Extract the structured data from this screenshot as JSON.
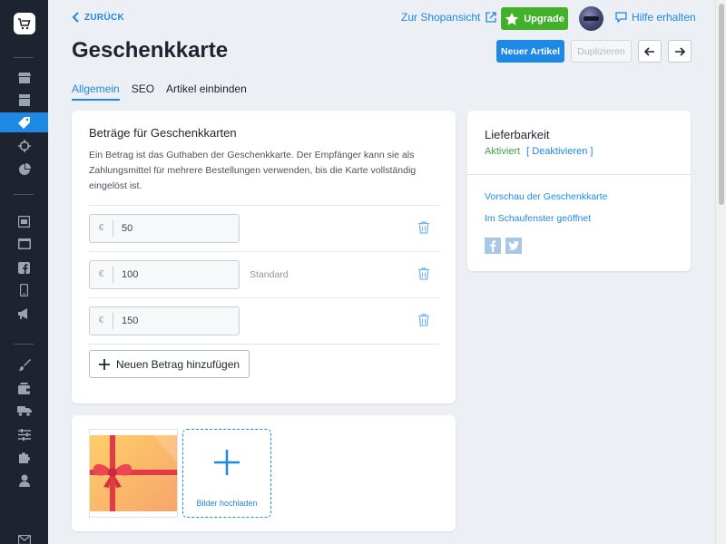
{
  "header": {
    "back_label": "ZURÜCK",
    "shop_link": "Zur Shopansicht",
    "upgrade_label": "Upgrade",
    "help_label": "Hilfe erhalten"
  },
  "page": {
    "title": "Geschenkkarte",
    "new_item_label": "Neuer Artikel",
    "duplicate_label": "Duplizieren"
  },
  "tabs": [
    {
      "label": "Allgemein",
      "active": true
    },
    {
      "label": "SEO",
      "active": false
    },
    {
      "label": "Artikel einbinden",
      "active": false
    }
  ],
  "amounts_card": {
    "title": "Beträge für Geschenkkarten",
    "description": "Ein Betrag ist das Guthaben der Geschenkkarte. Der Empfänger kann sie als Zahlungsmittel für mehrere Bestellungen verwenden, bis die Karte vollständig eingelöst ist.",
    "currency": "€",
    "rows": [
      {
        "value": "50",
        "badge": ""
      },
      {
        "value": "100",
        "badge": "Standard"
      },
      {
        "value": "150",
        "badge": ""
      }
    ],
    "add_label": "Neuen Betrag hinzufügen"
  },
  "delivery_card": {
    "title": "Lieferbarkeit",
    "status": "Aktiviert",
    "toggle_label": "[ Deaktivieren ]",
    "preview_link": "Vorschau der Geschenkkarte",
    "storefront_link": "Im Schaufenster geöffnet"
  },
  "images_card": {
    "upload_label": "Bilder hochladen"
  },
  "colors": {
    "accent": "#1e88e5",
    "upgrade": "#43b02a",
    "sidebar": "#1d2430",
    "status_green": "#43a047"
  },
  "sidebar_icons": [
    "shop-logo-icon",
    "store-icon",
    "inbox-icon",
    "tag-icon",
    "target-icon",
    "pie-chart-icon",
    "window-icon",
    "browser-icon",
    "facebook-icon",
    "mobile-icon",
    "megaphone-icon",
    "brush-icon",
    "wallet-icon",
    "truck-icon",
    "sliders-icon",
    "puzzle-icon",
    "user-icon",
    "mail-icon"
  ]
}
